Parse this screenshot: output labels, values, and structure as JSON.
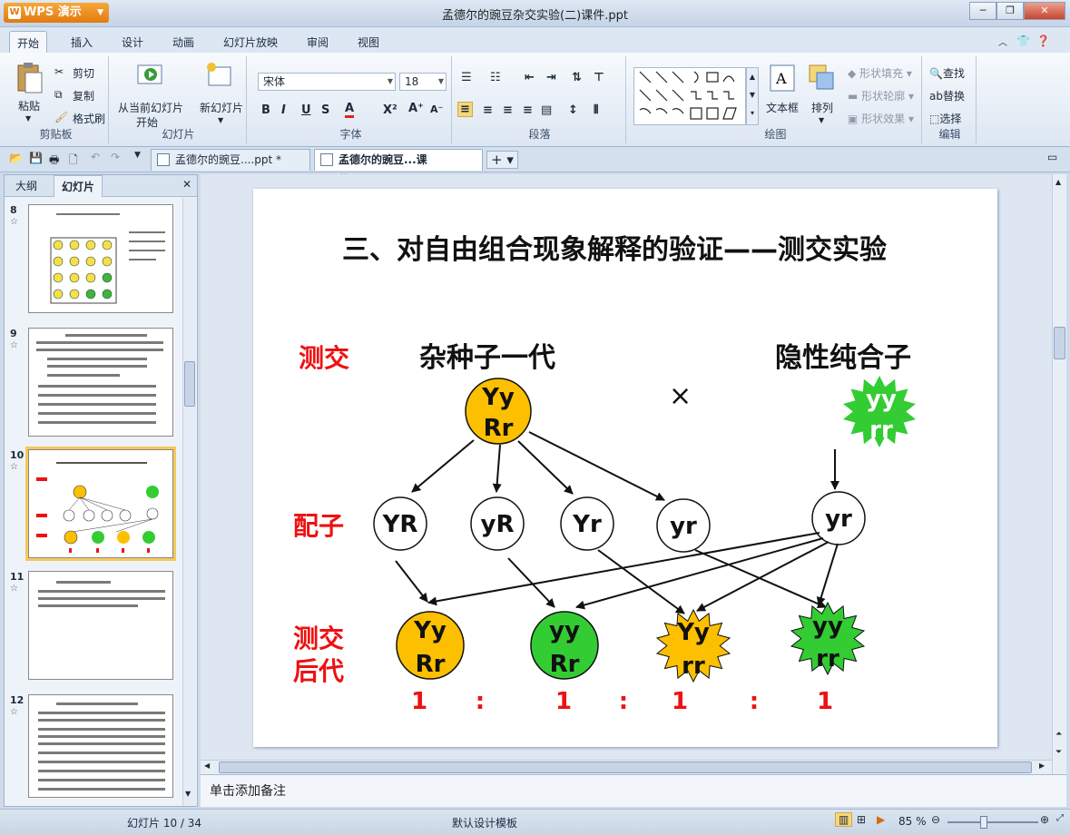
{
  "app": {
    "name": "WPS 演示",
    "window_title": "孟德尔的豌豆杂交实验(二)课件.ppt"
  },
  "menu_tabs": [
    "开始",
    "插入",
    "设计",
    "动画",
    "幻灯片放映",
    "审阅",
    "视图"
  ],
  "ribbon": {
    "clipboard": {
      "paste": "粘贴",
      "cut": "剪切",
      "copy": "复制",
      "format_painter": "格式刷",
      "label": "剪贴板"
    },
    "slides": {
      "from_current": "从当前幻灯片",
      "start": "开始",
      "new_slide": "新幻灯片",
      "label": "幻灯片"
    },
    "font": {
      "name": "宋体",
      "size": "18",
      "label": "字体"
    },
    "paragraph": {
      "label": "段落"
    },
    "drawing": {
      "textbox": "文本框",
      "arrange": "排列",
      "shape_fill": "形状填充",
      "shape_outline": "形状轮廓",
      "shape_effect": "形状效果",
      "label": "绘图"
    },
    "editing": {
      "find": "查找",
      "replace": "替换",
      "select": "选择",
      "label": "编辑"
    }
  },
  "doc_tabs": [
    "孟德尔的豌豆....ppt *",
    "孟德尔的豌豆...课件.ppt"
  ],
  "left_pane": {
    "tab_outline": "大纲",
    "tab_slides": "幻灯片",
    "slide_numbers": [
      "8",
      "9",
      "10",
      "11",
      "12"
    ]
  },
  "slide": {
    "title": "三、对自由组合现象解释的验证——测交实验",
    "label_testcross": "测交",
    "label_hybrid": "杂种子一代",
    "label_recessive": "隐性纯合子",
    "cross_symbol": "×",
    "label_gametes": "配子",
    "label_offspring_line1": "测交",
    "label_offspring_line2": "后代",
    "parent1": {
      "line1": "Yy",
      "line2": "Rr"
    },
    "parent2": {
      "line1": "yy",
      "line2": "rr"
    },
    "gametes": [
      "YR",
      "yR",
      "Yr",
      "yr"
    ],
    "gamete_recessive": "yr",
    "offspring": [
      {
        "line1": "Yy",
        "line2": "Rr"
      },
      {
        "line1": "yy",
        "line2": "Rr"
      },
      {
        "line1": "Yy",
        "line2": "rr"
      },
      {
        "line1": "yy",
        "line2": "rr"
      }
    ],
    "ratio": [
      "1",
      ":",
      "1",
      ":",
      "1",
      ":",
      "1"
    ],
    "colors": {
      "yellow": "#fcc000",
      "green": "#33cc33",
      "red": "#ee1111"
    }
  },
  "notes_placeholder": "单击添加备注",
  "status": {
    "slide_position": "幻灯片 10 / 34",
    "template": "默认设计模板",
    "zoom": "85 %"
  }
}
